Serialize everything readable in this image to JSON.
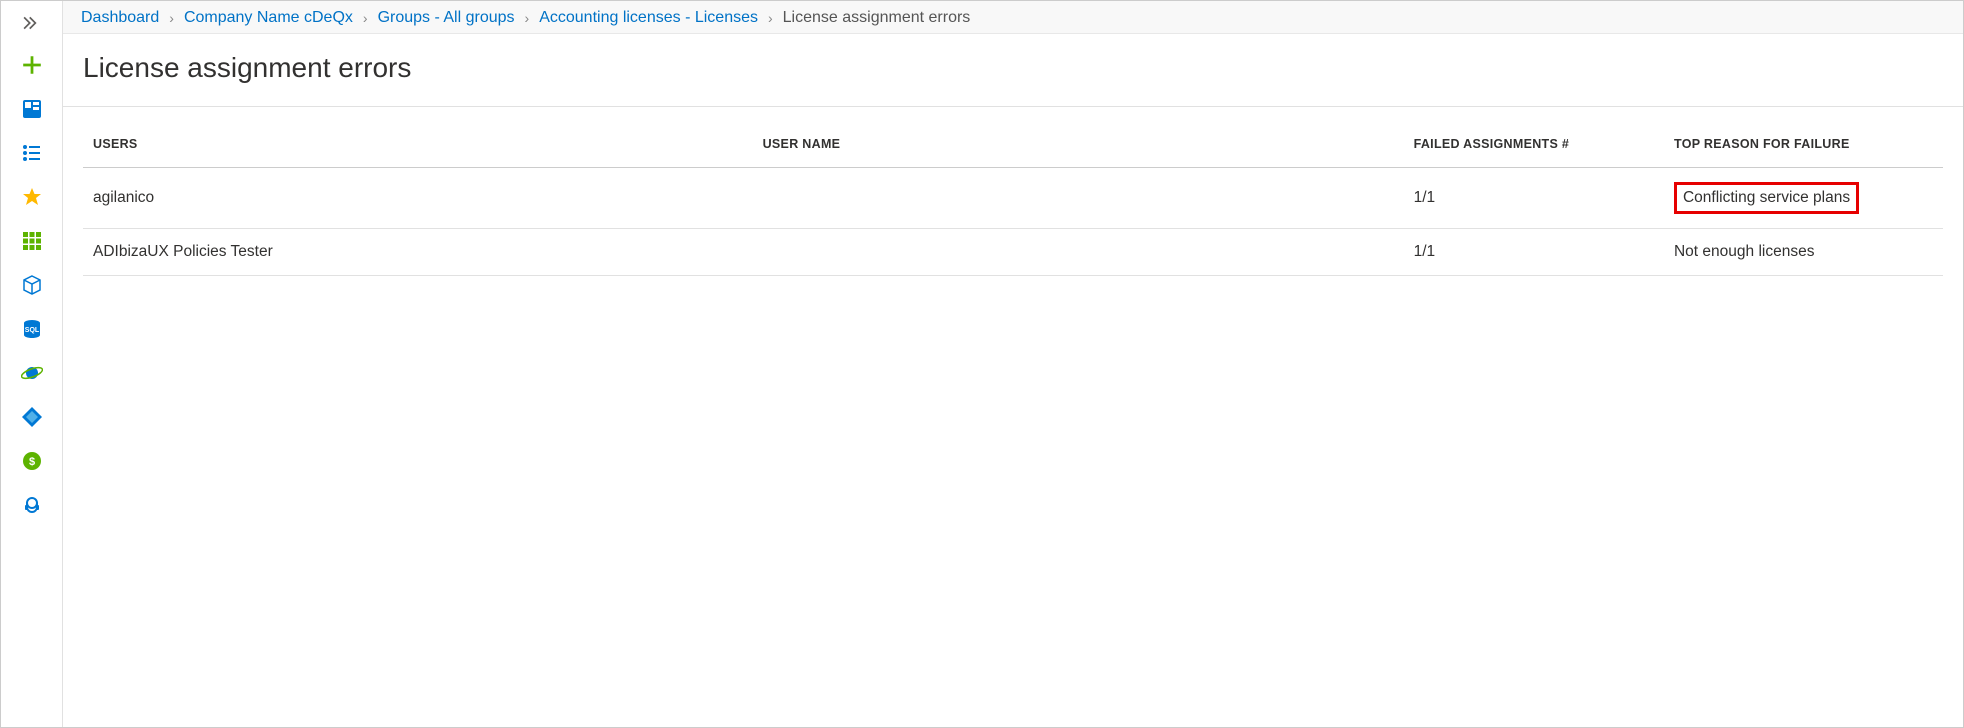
{
  "breadcrumb": {
    "items": [
      {
        "label": "Dashboard"
      },
      {
        "label": "Company Name cDeQx"
      },
      {
        "label": "Groups - All groups"
      },
      {
        "label": "Accounting licenses - Licenses"
      }
    ],
    "current": "License assignment errors"
  },
  "page": {
    "title": "License assignment errors"
  },
  "table": {
    "headers": {
      "users": "USERS",
      "username": "USER NAME",
      "failed": "FAILED ASSIGNMENTS #",
      "reason": "TOP REASON FOR FAILURE"
    },
    "rows": [
      {
        "users": "agilanico",
        "username": "",
        "failed": "1/1",
        "reason": "Conflicting service plans",
        "highlight": true
      },
      {
        "users": "ADIbizaUX Policies Tester",
        "username": "",
        "failed": "1/1",
        "reason": "Not enough licenses",
        "highlight": false
      }
    ]
  },
  "sidebar": {
    "icons": [
      "add-icon",
      "dashboard-icon",
      "list-icon",
      "star-icon",
      "apps-icon",
      "cube-icon",
      "sql-icon",
      "planet-icon",
      "diamond-icon",
      "cost-icon",
      "support-icon"
    ]
  }
}
